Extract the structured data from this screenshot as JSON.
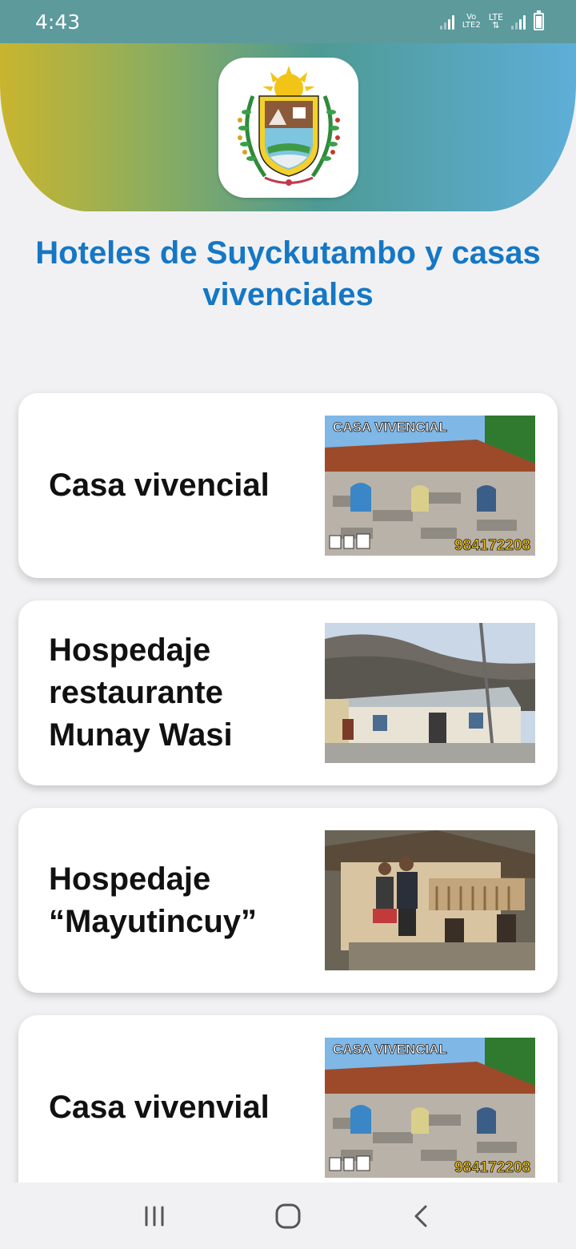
{
  "status_bar": {
    "time": "4:43",
    "network_label_1": "Vo\nLTE2",
    "network_label_2": "LTE",
    "battery_level": "7",
    "icons": [
      "signal-icon",
      "volte-icon",
      "lte-icon",
      "signal-icon",
      "battery-icon"
    ]
  },
  "header": {
    "logo_icon": "coat-of-arms-logo",
    "gradient": [
      "#c9b52e",
      "#4e9a94",
      "#5eaed8"
    ]
  },
  "page": {
    "title": "Hoteles de Suyckutambo y casas vivenciales",
    "title_color": "#1577c5"
  },
  "items": [
    {
      "title": "Casa vivencial",
      "image_icon": "casa-vivencial-photo",
      "image_banner": "CASA VIVENCIAL",
      "image_phone": "984172208"
    },
    {
      "title": "Hospedaje restaurante Munay Wasi",
      "image_icon": "munay-wasi-photo"
    },
    {
      "title": "Hospedaje “Mayutincuy”",
      "image_icon": "mayutincuy-photo"
    },
    {
      "title": "Casa vivenvial",
      "image_icon": "casa-vivencial-photo",
      "image_banner": "CASA VIVENCIAL",
      "image_phone": "984172208"
    }
  ],
  "nav_bar": {
    "recents_icon": "recents-icon",
    "home_icon": "home-icon",
    "back_icon": "back-icon"
  }
}
